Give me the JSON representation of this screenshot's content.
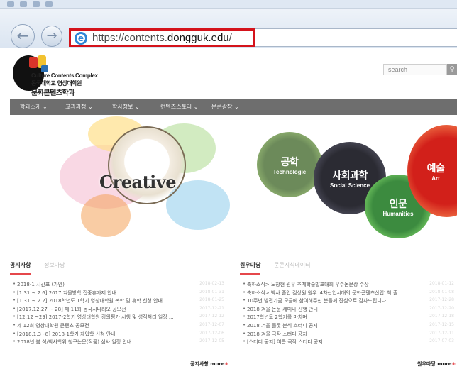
{
  "browser": {
    "url_prefix": "https://contents.",
    "url_domain": "dongguk.edu",
    "url_suffix": "/"
  },
  "site": {
    "logo_en": "Culture Contents Complex",
    "logo_ko_line1": "동국대학교 영상대학원",
    "logo_ko_line2": "문화콘텐츠학과",
    "search_placeholder": "search"
  },
  "menu": [
    "학과소개 ⌄",
    "교과과정 ⌄",
    "학사정보 ⌄",
    "컨텐츠스토리 ⌄",
    "문콘광장 ⌄"
  ],
  "hero": {
    "creative": "Creative",
    "circles": [
      {
        "ko": "공학",
        "en": "Technologie"
      },
      {
        "ko": "사회과학",
        "en": "Social Science"
      },
      {
        "ko": "인문",
        "en": "Humanities"
      },
      {
        "ko": "예술",
        "en": "Art"
      }
    ]
  },
  "notices": {
    "tab_active": "공지사항",
    "tab_inactive": "정보마당",
    "more": "공지사항 more",
    "items": [
      {
        "title": "2018-1 시간표 (가안)",
        "date": "2018-02-13"
      },
      {
        "title": "[1.31 ~ 2.6] 2017 겨울방학 집중휴가제 안내",
        "date": "2018-01-31"
      },
      {
        "title": "[1.31 ~ 2.2] 2018학년도 1학기 영상대학원 복학 및 휴학 신청 안내",
        "date": "2018-01-25"
      },
      {
        "title": "[2017.12.27 ~ 28] 제 11회 동국시나리오 공모전",
        "date": "2017-12-21"
      },
      {
        "title": "[12.12 ~29] 2017-2학기 영상대학원 강의평가 시행 및 성적처리 일정 ...",
        "date": "2017-12-12"
      },
      {
        "title": "제 12회 영상대학원 콘텐츠 공모전",
        "date": "2017-12-07"
      },
      {
        "title": "[2018.1.3~8] 2018-1학기 재입학 신청 안내",
        "date": "2017-12-06"
      },
      {
        "title": "2018년 봄 석/박사학위 청구논문(작품) 심사 일정 안내",
        "date": "2017-12-05"
      }
    ]
  },
  "community": {
    "tab_active": "원우마당",
    "tab_inactive": "문콘지식데이터",
    "more": "원우마당 more",
    "items": [
      {
        "title": "축하소식> 노창현 원우 추계학술발표대회 우수논문상 수상",
        "date": "2018-01-12"
      },
      {
        "title": "축하소식> 박사 졸업 김상원 원우 '4차산업시대의 문화콘텐츠산업' 책 출...",
        "date": "2018-01-08"
      },
      {
        "title": "10주년 발전기금 모금에 참여해주신 분들께 진심으로 감사드립니다.",
        "date": "2017-12-28"
      },
      {
        "title": "2018 겨울 논문 세미나 진행 안내",
        "date": "2017-12-20"
      },
      {
        "title": "2017학년도 2학기를 마치며",
        "date": "2017-12-18"
      },
      {
        "title": "2018 겨울 플롯 분석 스터디 공지",
        "date": "2017-12-15"
      },
      {
        "title": "2018 겨울 극작 스터디 공지",
        "date": "2017-12-11"
      },
      {
        "title": "[스터디 공지] 여름 극작 스터디 공지",
        "date": "2017-07-03"
      }
    ]
  }
}
